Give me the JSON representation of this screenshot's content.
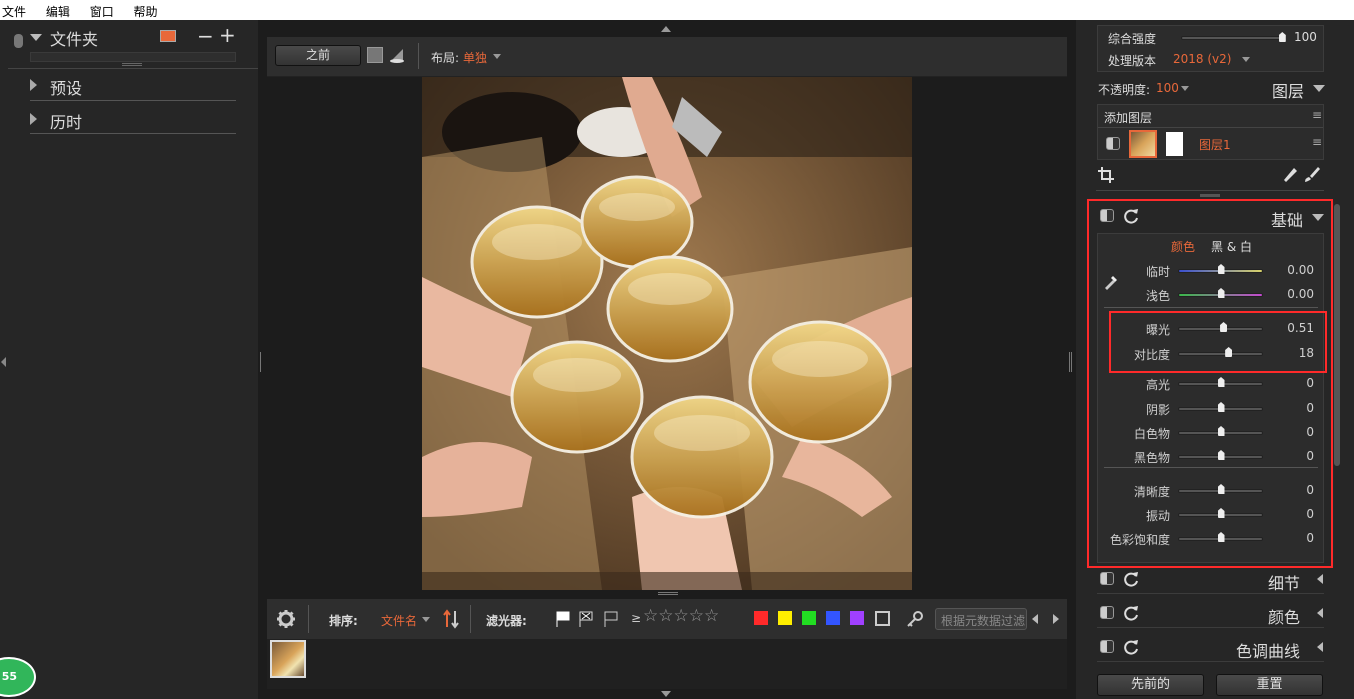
{
  "menu": [
    "文件",
    "编辑",
    "窗口",
    "帮助"
  ],
  "left": {
    "folder_title": "文件夹",
    "sections": [
      "预设",
      "历时"
    ]
  },
  "toolbar": {
    "before_label": "之前",
    "layout_label": "布局:",
    "layout_value": "单独"
  },
  "filmbar": {
    "sort_label": "排序:",
    "sort_value": "文件名",
    "filter_label": "滤光器:",
    "ge": "≥",
    "search_placeholder": "根据元数据过滤",
    "colors": [
      "#ff2a2a",
      "#ffee00",
      "#22dd22",
      "#3355ff",
      "#a040ff"
    ]
  },
  "right": {
    "strength_label": "综合强度",
    "strength_value": "100",
    "strength_pct": 0.96,
    "process_label": "处理版本",
    "process_value": "2018 (v2)",
    "opacity_label": "不透明度:",
    "opacity_value": "100",
    "layers_title": "图层",
    "add_layer": "添加图层",
    "layer1": "图层1",
    "basic_title": "基础",
    "tab_color": "颜色",
    "tab_bw": "黑 & 白",
    "sliders": [
      {
        "label": "临时",
        "value": "0.00",
        "pos": 0.5,
        "track": "temp"
      },
      {
        "label": "浅色",
        "value": "0.00",
        "pos": 0.5,
        "track": "tint"
      },
      {
        "label": "曝光",
        "value": "0.51",
        "pos": 0.53,
        "track": "plain"
      },
      {
        "label": "对比度",
        "value": "18",
        "pos": 0.59,
        "track": "plain"
      },
      {
        "label": "高光",
        "value": "0",
        "pos": 0.5,
        "track": "plain"
      },
      {
        "label": "阴影",
        "value": "0",
        "pos": 0.5,
        "track": "plain"
      },
      {
        "label": "白色物",
        "value": "0",
        "pos": 0.5,
        "track": "plain"
      },
      {
        "label": "黑色物",
        "value": "0",
        "pos": 0.5,
        "track": "plain"
      },
      {
        "label": "清晰度",
        "value": "0",
        "pos": 0.5,
        "track": "plain"
      },
      {
        "label": "振动",
        "value": "0",
        "pos": 0.5,
        "track": "plain"
      },
      {
        "label": "色彩饱和度",
        "value": "0",
        "pos": 0.5,
        "track": "plain"
      }
    ],
    "panels": [
      "细节",
      "颜色",
      "色调曲线"
    ],
    "prev_button": "先前的",
    "reset_button": "重置"
  },
  "badge": "55"
}
